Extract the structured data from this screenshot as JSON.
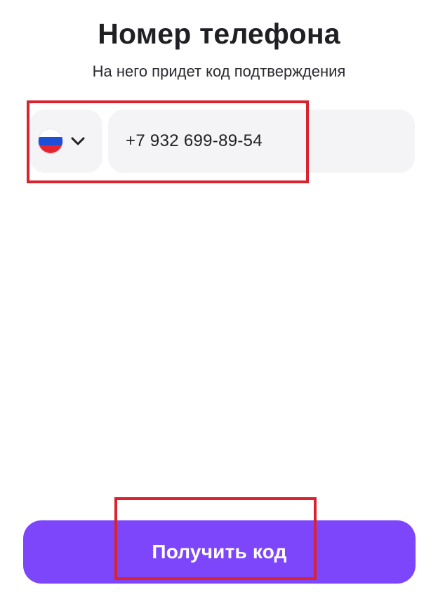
{
  "header": {
    "title": "Номер телефона",
    "subtitle": "На него придет код подтверждения"
  },
  "country_picker": {
    "flag_icon": "russia-flag-icon",
    "chevron_icon": "chevron-down-icon"
  },
  "phone_input": {
    "value": "+7 932 699-89-54"
  },
  "submit": {
    "label": "Получить код"
  },
  "colors": {
    "accent": "#7d46fb",
    "field_background": "#f4f4f6",
    "highlight": "#d9232f",
    "flag_white": "#ffffff",
    "flag_blue": "#1c4ed8",
    "flag_red": "#e5242f"
  }
}
